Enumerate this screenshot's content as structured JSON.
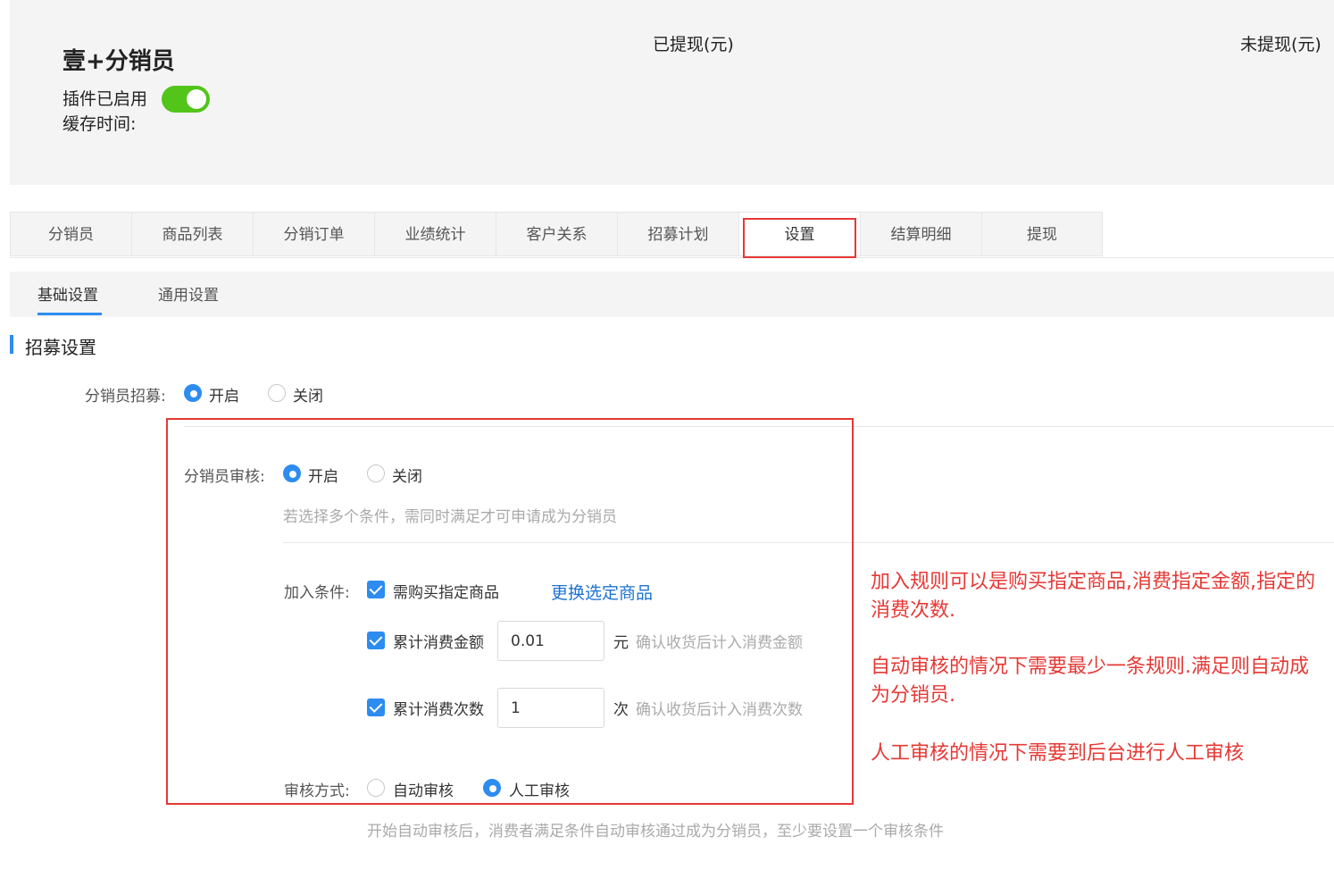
{
  "header": {
    "title": "壹+分销员",
    "plugin_status": "插件已启用",
    "cache_label": "缓存时间:",
    "withdrawn_label": "已提现(元)",
    "pending_label": "未提现(元)",
    "toggle_on": true
  },
  "tabs": [
    {
      "label": "分销员"
    },
    {
      "label": "商品列表"
    },
    {
      "label": "分销订单"
    },
    {
      "label": "业绩统计"
    },
    {
      "label": "客户关系"
    },
    {
      "label": "招募计划"
    },
    {
      "label": "设置",
      "active": true
    },
    {
      "label": "结算明细"
    },
    {
      "label": "提现"
    }
  ],
  "subtabs": [
    {
      "label": "基础设置",
      "active": true
    },
    {
      "label": "通用设置"
    }
  ],
  "section": {
    "title": "招募设置"
  },
  "form": {
    "recruit": {
      "label": "分销员招募:",
      "on": "开启",
      "off": "关闭",
      "selected": "开启"
    },
    "review": {
      "label": "分销员审核:",
      "on": "开启",
      "off": "关闭",
      "selected": "开启",
      "hint": "若选择多个条件，需同时满足才可申请成为分销员"
    },
    "join": {
      "label": "加入条件:",
      "buy_product": {
        "label": "需购买指定商品",
        "checked": true
      },
      "change_link": "更换选定商品",
      "amount": {
        "label": "累计消费金额",
        "value": "0.01",
        "unit": "元",
        "hint": "确认收货后计入消费金额",
        "checked": true
      },
      "count": {
        "label": "累计消费次数",
        "value": "1",
        "unit": "次",
        "hint": "确认收货后计入消费次数",
        "checked": true
      }
    },
    "method": {
      "label": "审核方式:",
      "auto": "自动审核",
      "manual": "人工审核",
      "selected": "人工审核",
      "hint": "开始自动审核后，消费者满足条件自动审核通过成为分销员，至少要设置一个审核条件"
    }
  },
  "annotations": {
    "line1": "加入规则可以是购买指定商品,消费指定金额,指定的消费次数.",
    "line2": "自动审核的情况下需要最少一条规则.满足则自动成为分销员.",
    "line3": "人工审核的情况下需要到后台进行人工审核"
  },
  "colors": {
    "accent": "#2d8cf0",
    "toggle": "#52c41a",
    "highlight": "#e53935",
    "link": "#1f73d1"
  }
}
